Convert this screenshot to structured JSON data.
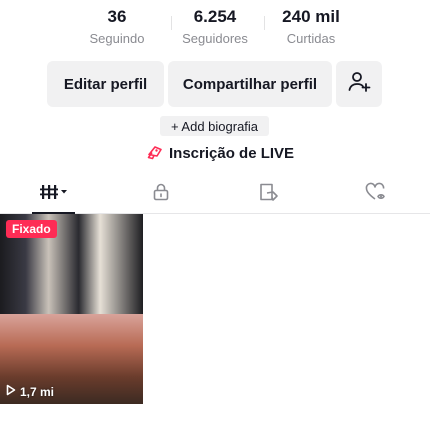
{
  "stats": [
    {
      "value": "36",
      "label": "Seguindo"
    },
    {
      "value": "6.254",
      "label": "Seguidores"
    },
    {
      "value": "240 mil",
      "label": "Curtidas"
    }
  ],
  "buttons": {
    "edit_profile": "Editar perfil",
    "share_profile": "Compartilhar perfil",
    "add_friend_icon": "add-user-icon"
  },
  "bio": {
    "add_label": "+ Add biografia"
  },
  "live": {
    "icon": "live-subscription-icon",
    "label": "Inscrição de LIVE"
  },
  "tabs": [
    {
      "icon": "grid-icon",
      "active": true
    },
    {
      "icon": "lock-icon",
      "active": false
    },
    {
      "icon": "repost-icon",
      "active": false
    },
    {
      "icon": "liked-icon",
      "active": false
    }
  ],
  "videos": [
    {
      "pinned_label": "Fixado"
    },
    {
      "views": "1,7 mi"
    }
  ],
  "colors": {
    "accent": "#fe2c55",
    "text": "#161823",
    "muted": "#8a8b91",
    "chip_bg": "#f1f1f2"
  }
}
